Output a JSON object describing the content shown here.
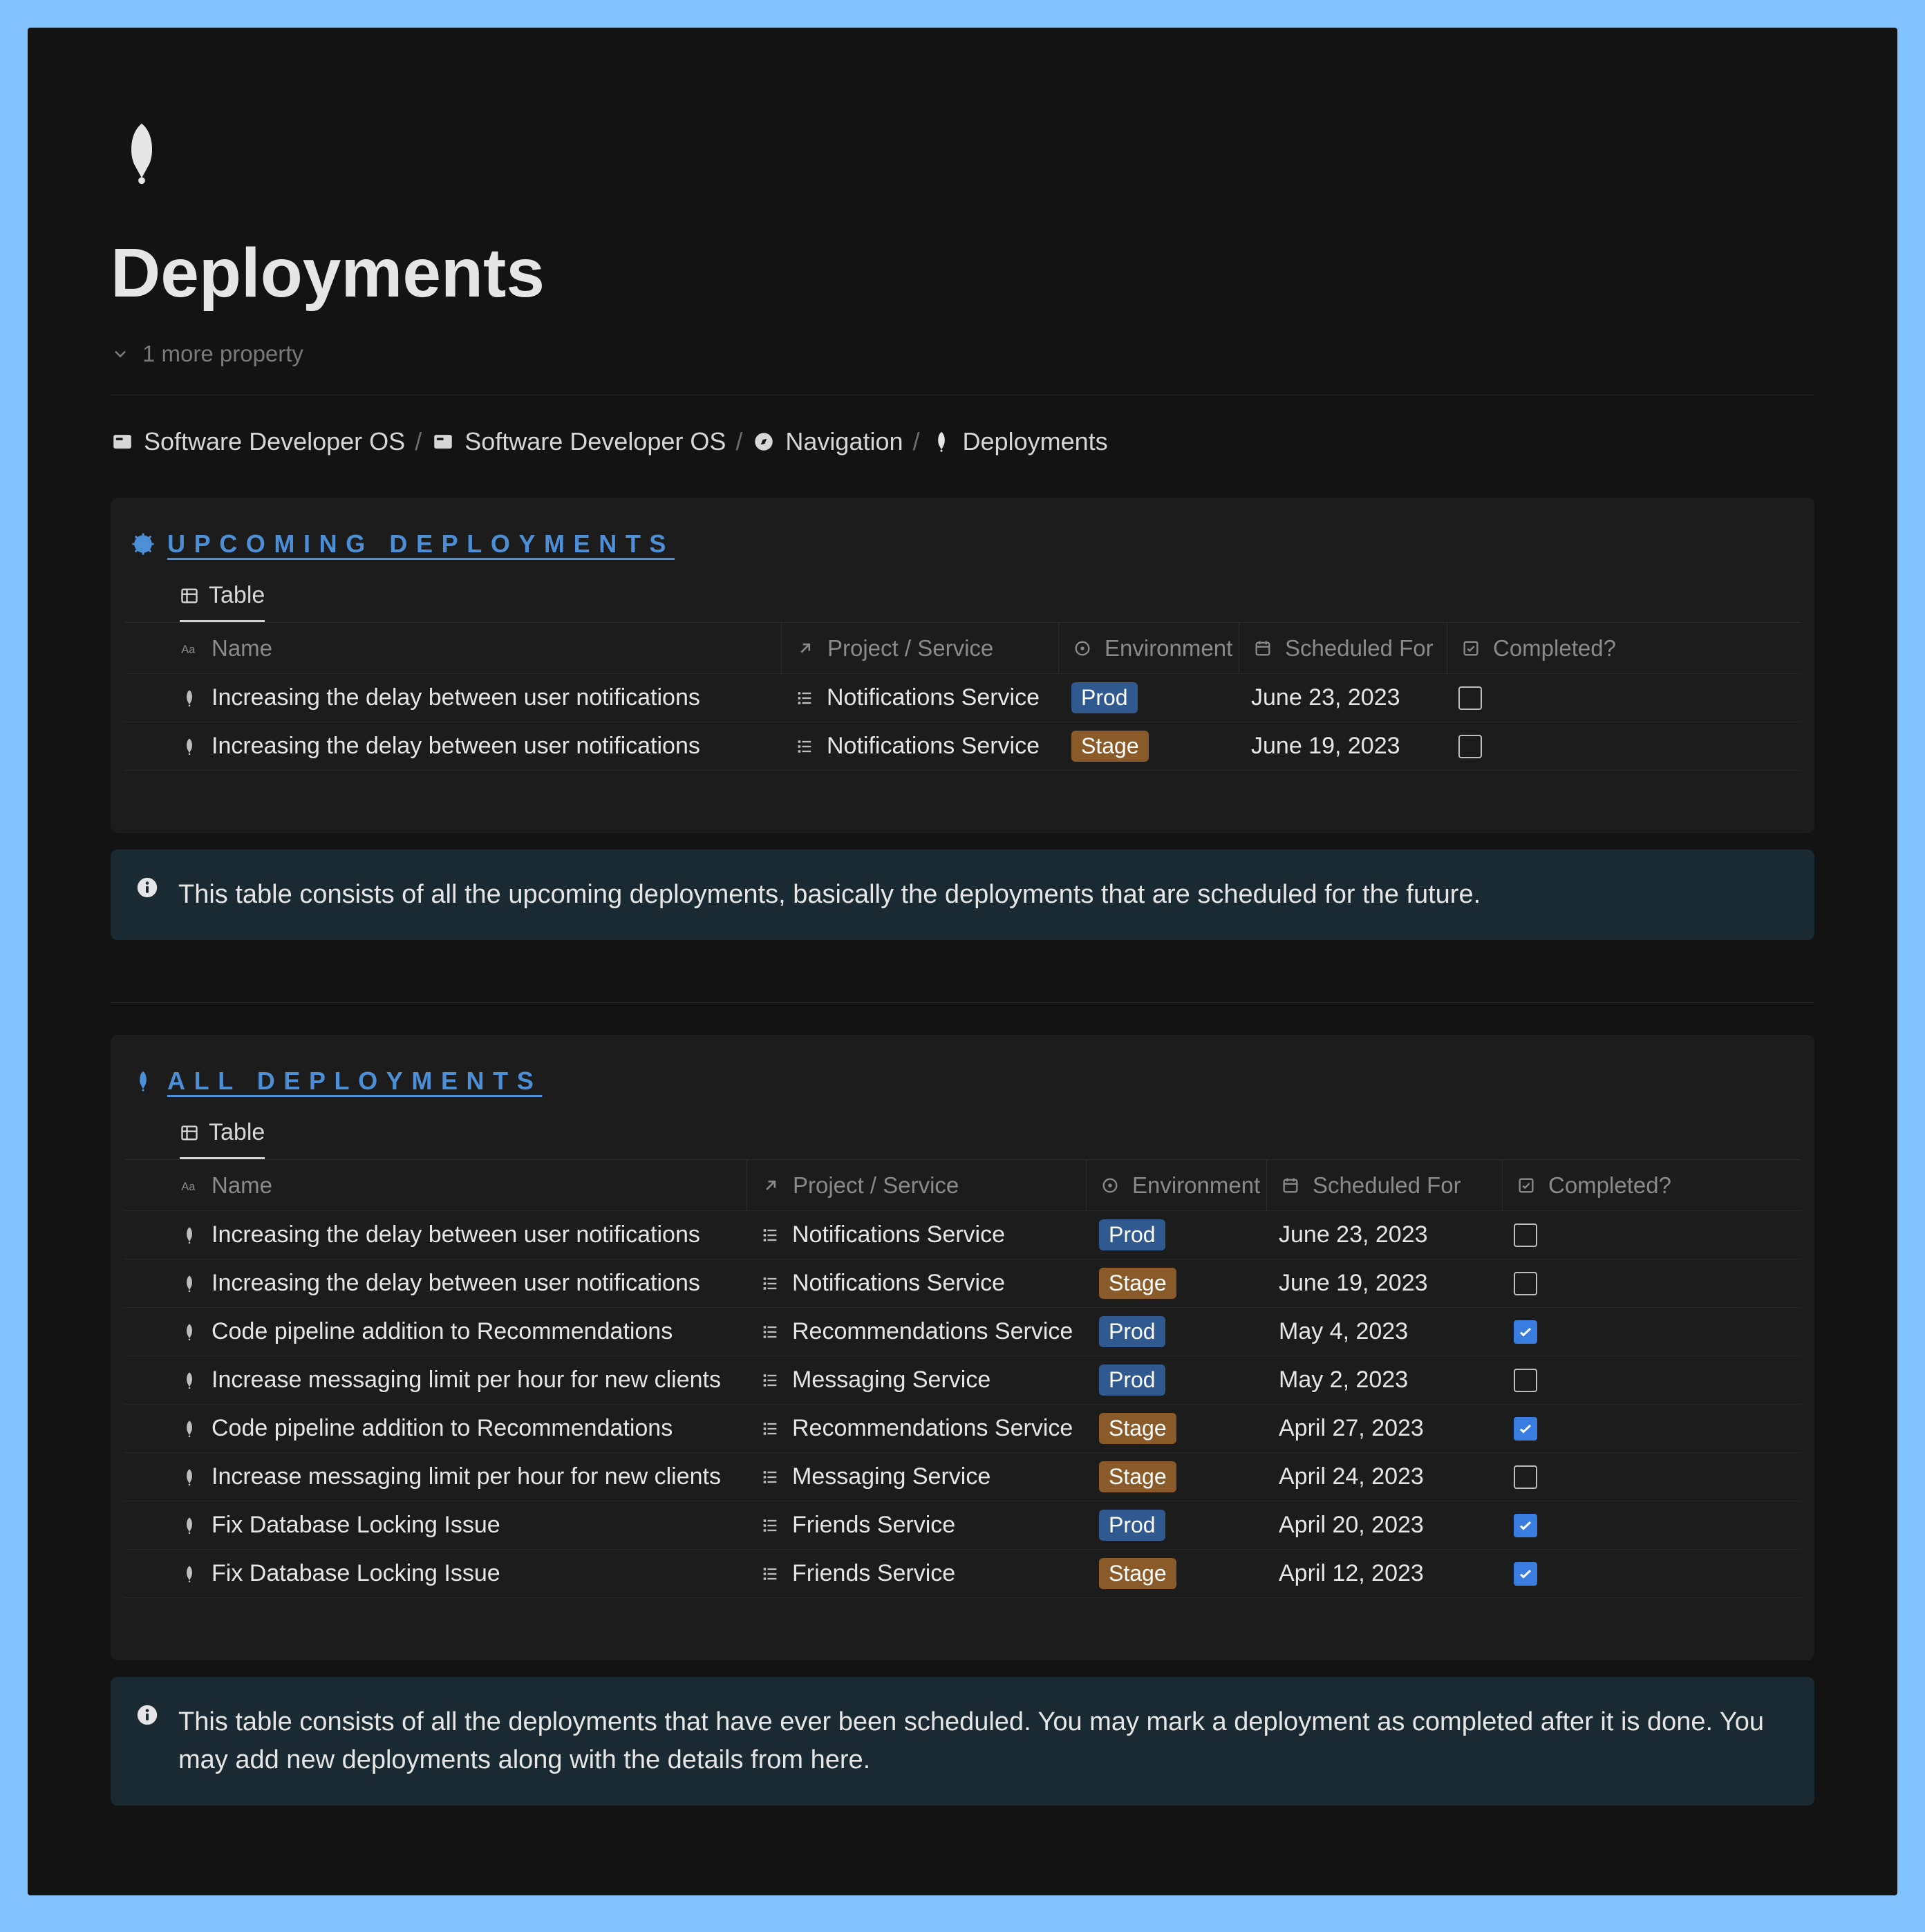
{
  "page": {
    "title": "Deployments",
    "more_properties": "1 more property"
  },
  "breadcrumb": {
    "items": [
      {
        "label": "Software Developer OS",
        "icon": "card"
      },
      {
        "label": "Software Developer OS",
        "icon": "card"
      },
      {
        "label": "Navigation",
        "icon": "compass"
      },
      {
        "label": "Deployments",
        "icon": "rocket"
      }
    ],
    "separator": "/"
  },
  "upcoming": {
    "title": "UPCOMING DEPLOYMENTS",
    "tab_label": "Table",
    "columns": {
      "name": "Name",
      "project": "Project / Service",
      "environment": "Environment",
      "scheduled": "Scheduled For",
      "completed": "Completed?"
    },
    "rows": [
      {
        "name": "Increasing the delay between user notifications",
        "project": "Notifications Service",
        "env": "Prod",
        "date": "June 23, 2023",
        "done": false
      },
      {
        "name": "Increasing the delay between user notifications",
        "project": "Notifications Service",
        "env": "Stage",
        "date": "June 19, 2023",
        "done": false
      }
    ]
  },
  "upcoming_info": "This table consists of all the upcoming deployments, basically the deployments that are scheduled for the future.",
  "all": {
    "title": "ALL DEPLOYMENTS",
    "tab_label": "Table",
    "columns": {
      "name": "Name",
      "project": "Project / Service",
      "environment": "Environment",
      "scheduled": "Scheduled For",
      "completed": "Completed?"
    },
    "rows": [
      {
        "name": "Increasing the delay between user notifications",
        "project": "Notifications Service",
        "env": "Prod",
        "date": "June 23, 2023",
        "done": false
      },
      {
        "name": "Increasing the delay between user notifications",
        "project": "Notifications Service",
        "env": "Stage",
        "date": "June 19, 2023",
        "done": false
      },
      {
        "name": "Code pipeline addition to Recommendations",
        "project": "Recommendations Service",
        "env": "Prod",
        "date": "May 4, 2023",
        "done": true
      },
      {
        "name": "Increase messaging limit per hour for new clients",
        "project": "Messaging Service",
        "env": "Prod",
        "date": "May 2, 2023",
        "done": false
      },
      {
        "name": "Code pipeline addition to Recommendations",
        "project": "Recommendations Service",
        "env": "Stage",
        "date": "April 27, 2023",
        "done": true
      },
      {
        "name": "Increase messaging limit per hour for new clients",
        "project": "Messaging Service",
        "env": "Stage",
        "date": "April 24, 2023",
        "done": false
      },
      {
        "name": "Fix Database Locking Issue",
        "project": "Friends Service",
        "env": "Prod",
        "date": "April 20, 2023",
        "done": true
      },
      {
        "name": "Fix Database Locking Issue",
        "project": "Friends Service",
        "env": "Stage",
        "date": "April 12, 2023",
        "done": true
      }
    ]
  },
  "all_info": "This table consists of all the deployments that have ever been scheduled. You may mark a deployment as completed after it is done. You may add new deployments along with the details from here."
}
